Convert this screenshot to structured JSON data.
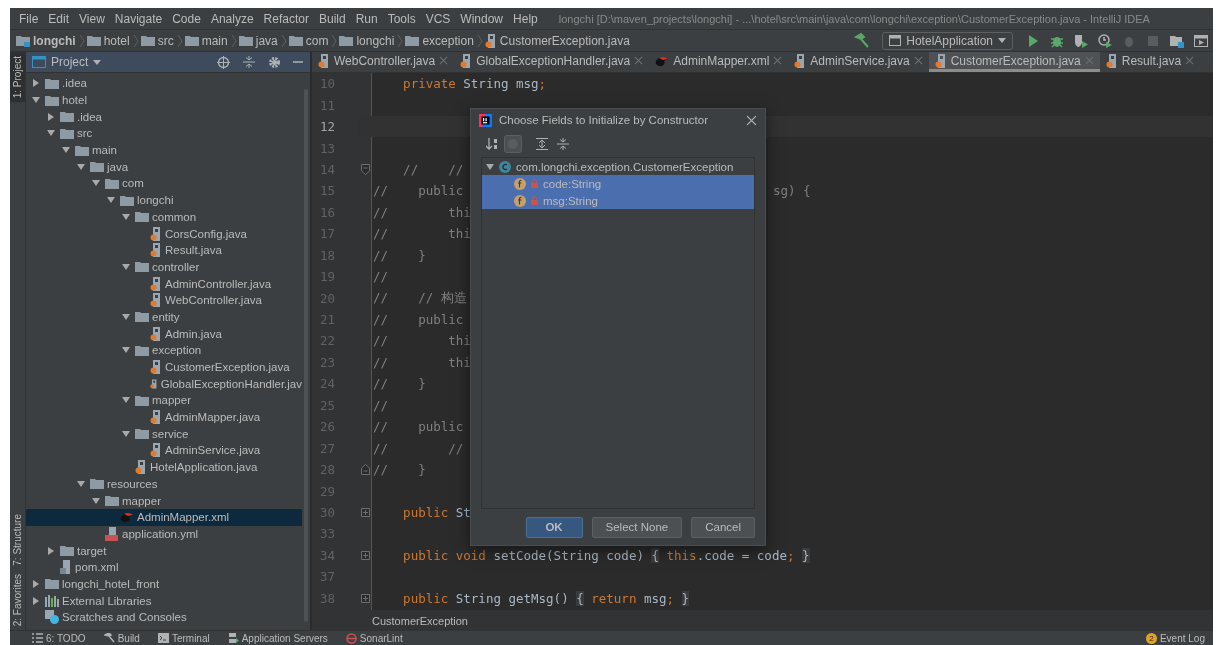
{
  "window": {
    "title": "longchi [D:\\maven_projects\\longchi] - ...\\hotel\\src\\main\\java\\com\\longchi\\exception\\CustomerException.java - IntelliJ IDEA"
  },
  "menu": [
    "File",
    "Edit",
    "View",
    "Navigate",
    "Code",
    "Analyze",
    "Refactor",
    "Build",
    "Run",
    "Tools",
    "VCS",
    "Window",
    "Help"
  ],
  "breadcrumbs": [
    {
      "label": "longchi",
      "kind": "module"
    },
    {
      "label": "hotel",
      "kind": "folder"
    },
    {
      "label": "src",
      "kind": "folder"
    },
    {
      "label": "main",
      "kind": "folder"
    },
    {
      "label": "java",
      "kind": "folder"
    },
    {
      "label": "com",
      "kind": "folder"
    },
    {
      "label": "longchi",
      "kind": "folder"
    },
    {
      "label": "exception",
      "kind": "folder"
    },
    {
      "label": "CustomerException.java",
      "kind": "java"
    }
  ],
  "run_config": {
    "label": "HotelApplication"
  },
  "toolbar": [
    {
      "kind": "run",
      "disabled": false
    },
    {
      "kind": "debug",
      "disabled": false
    },
    {
      "kind": "coverage",
      "disabled": false
    },
    {
      "kind": "profile",
      "disabled": false
    },
    {
      "kind": "attach",
      "disabled": true
    },
    {
      "kind": "stop",
      "disabled": true
    },
    {
      "kind": "structure",
      "disabled": false
    },
    {
      "kind": "presentation",
      "disabled": false
    }
  ],
  "tool_strip": [
    {
      "label": "1: Project",
      "kind": "top",
      "selected": true
    },
    {
      "label": "7: Structure",
      "kind": "bottom",
      "selected": false
    },
    {
      "label": "2: Favorites",
      "kind": "bottom",
      "selected": false
    }
  ],
  "project_panel": {
    "title": "Project",
    "tree": [
      {
        "children": [
          {
            "label": ".idea",
            "kind": "folder",
            "expanded": false,
            "selected": false
          },
          {
            "label": "hotel",
            "kind": "folder",
            "expanded": true,
            "selected": false,
            "children": [
              {
                "label": ".idea",
                "kind": "folder",
                "expanded": false,
                "selected": false
              },
              {
                "label": "src",
                "kind": "folder",
                "expanded": true,
                "selected": false,
                "children": [
                  {
                    "label": "main",
                    "kind": "folder",
                    "expanded": true,
                    "selected": false,
                    "children": [
                      {
                        "label": "java",
                        "kind": "folder",
                        "expanded": true,
                        "selected": false,
                        "children": [
                          {
                            "label": "com",
                            "kind": "folder",
                            "expanded": true,
                            "selected": false,
                            "children": [
                              {
                                "label": "longchi",
                                "kind": "folder",
                                "expanded": true,
                                "selected": false,
                                "children": [
                                  {
                                    "label": "common",
                                    "kind": "folder",
                                    "expanded": true,
                                    "selected": false,
                                    "children": [
                                      {
                                        "label": "CorsConfig.java",
                                        "kind": "java",
                                        "selected": false
                                      },
                                      {
                                        "label": "Result.java",
                                        "kind": "java",
                                        "selected": false
                                      }
                                    ]
                                  },
                                  {
                                    "label": "controller",
                                    "kind": "folder",
                                    "expanded": true,
                                    "selected": false,
                                    "children": [
                                      {
                                        "label": "AdminController.java",
                                        "kind": "java",
                                        "selected": false
                                      },
                                      {
                                        "label": "WebController.java",
                                        "kind": "java",
                                        "selected": false
                                      }
                                    ]
                                  },
                                  {
                                    "label": "entity",
                                    "kind": "folder",
                                    "expanded": true,
                                    "selected": false,
                                    "children": [
                                      {
                                        "label": "Admin.java",
                                        "kind": "java",
                                        "selected": false
                                      }
                                    ]
                                  },
                                  {
                                    "label": "exception",
                                    "kind": "folder",
                                    "expanded": true,
                                    "selected": false,
                                    "children": [
                                      {
                                        "label": "CustomerException.java",
                                        "kind": "java",
                                        "selected": false
                                      },
                                      {
                                        "label": "GlobalExceptionHandler.jav",
                                        "kind": "java",
                                        "selected": false
                                      }
                                    ]
                                  },
                                  {
                                    "label": "mapper",
                                    "kind": "folder",
                                    "expanded": true,
                                    "selected": false,
                                    "children": [
                                      {
                                        "label": "AdminMapper.java",
                                        "kind": "java",
                                        "selected": false
                                      }
                                    ]
                                  },
                                  {
                                    "label": "service",
                                    "kind": "folder",
                                    "expanded": true,
                                    "selected": false,
                                    "children": [
                                      {
                                        "label": "AdminService.java",
                                        "kind": "java",
                                        "selected": false
                                      }
                                    ]
                                  },
                                  {
                                    "label": "HotelApplication.java",
                                    "kind": "java",
                                    "selected": false
                                  }
                                ]
                              }
                            ]
                          }
                        ]
                      },
                      {
                        "label": "resources",
                        "kind": "folder",
                        "expanded": true,
                        "selected": false,
                        "children": [
                          {
                            "label": "mapper",
                            "kind": "folder",
                            "expanded": true,
                            "selected": false,
                            "children": [
                              {
                                "label": "AdminMapper.xml",
                                "kind": "xml",
                                "selected": true
                              }
                            ]
                          },
                          {
                            "label": "application.yml",
                            "kind": "yml",
                            "selected": false
                          }
                        ]
                      }
                    ]
                  }
                ]
              },
              {
                "label": "target",
                "kind": "folder",
                "expanded": false,
                "selected": false
              },
              {
                "label": "pom.xml",
                "kind": "maven",
                "selected": false
              }
            ]
          },
          {
            "label": "longchi_hotel_front",
            "kind": "folder",
            "expanded": false,
            "selected": false
          }
        ]
      },
      {
        "label": "External Libraries",
        "kind": "libraries",
        "expanded": false,
        "selected": false
      },
      {
        "label": "Scratches and Consoles",
        "kind": "scratches",
        "selected": false
      }
    ]
  },
  "editor": {
    "tabs": [
      {
        "label": "WebController.java",
        "kind": "java",
        "selected": false
      },
      {
        "label": "GlobalExceptionHandler.java",
        "kind": "java",
        "selected": false
      },
      {
        "label": "AdminMapper.xml",
        "kind": "xml",
        "selected": false
      },
      {
        "label": "AdminService.java",
        "kind": "java",
        "selected": false
      },
      {
        "label": "CustomerException.java",
        "kind": "java",
        "selected": true
      },
      {
        "label": "Result.java",
        "kind": "java",
        "selected": false
      }
    ],
    "lines": [
      {
        "number": "10",
        "current": false,
        "segments": [
          {
            "text": "    private",
            "kind": "keyword"
          },
          {
            "text": " String msg"
          },
          {
            "text": ";",
            "kind": "keyword"
          }
        ]
      },
      {
        "number": "11",
        "current": false
      },
      {
        "number": "12",
        "current": true
      },
      {
        "number": "13",
        "current": false
      },
      {
        "number": "14",
        "current": false,
        "kind": "open",
        "segments": [
          {
            "text": "    //    //",
            "kind": "comment"
          }
        ]
      },
      {
        "number": "15",
        "current": false,
        "segments": [
          {
            "text": "//    public",
            "kind": "comment"
          }
        ],
        "tail": [
          {
            "text": "sg) {",
            "kind": "comment"
          }
        ]
      },
      {
        "number": "16",
        "current": false,
        "segments": [
          {
            "text": "//        thi",
            "kind": "comment"
          }
        ]
      },
      {
        "number": "17",
        "current": false,
        "segments": [
          {
            "text": "//        thi",
            "kind": "comment"
          }
        ]
      },
      {
        "number": "18",
        "current": false,
        "segments": [
          {
            "text": "//    }",
            "kind": "comment"
          }
        ]
      },
      {
        "number": "19",
        "current": false,
        "segments": [
          {
            "text": "//",
            "kind": "comment"
          }
        ]
      },
      {
        "number": "20",
        "current": false,
        "segments": [
          {
            "text": "//    // 构造",
            "kind": "comment"
          }
        ]
      },
      {
        "number": "21",
        "current": false,
        "segments": [
          {
            "text": "//    public",
            "kind": "comment"
          }
        ]
      },
      {
        "number": "22",
        "current": false,
        "segments": [
          {
            "text": "//        thi",
            "kind": "comment"
          }
        ]
      },
      {
        "number": "23",
        "current": false,
        "segments": [
          {
            "text": "//        thi",
            "kind": "comment"
          }
        ]
      },
      {
        "number": "24",
        "current": false,
        "segments": [
          {
            "text": "//    }",
            "kind": "comment"
          }
        ]
      },
      {
        "number": "25",
        "current": false,
        "segments": [
          {
            "text": "//",
            "kind": "comment"
          }
        ]
      },
      {
        "number": "26",
        "current": false,
        "segments": [
          {
            "text": "//    public",
            "kind": "comment"
          }
        ]
      },
      {
        "number": "27",
        "current": false,
        "segments": [
          {
            "text": "//        //",
            "kind": "comment"
          }
        ]
      },
      {
        "number": "28",
        "current": false,
        "kind": "close",
        "segments": [
          {
            "text": "//    }",
            "kind": "comment"
          }
        ]
      },
      {
        "number": "29",
        "current": false
      },
      {
        "number": "30",
        "current": false,
        "kind": "collapsed",
        "segments": [
          {
            "text": "    public",
            "kind": "keyword"
          },
          {
            "text": " St"
          }
        ]
      },
      {
        "number": "33",
        "current": false
      },
      {
        "number": "34",
        "current": false,
        "kind": "collapsed",
        "segments": [
          {
            "text": "    public void",
            "kind": "keyword"
          },
          {
            "text": " setCode(String code) "
          },
          {
            "text": "{",
            "kind": "folded"
          },
          {
            "text": " this",
            "kind": "keyword"
          },
          {
            "text": ".code = code"
          },
          {
            "text": "; ",
            "kind": "keyword"
          },
          {
            "text": "}",
            "kind": "folded"
          }
        ]
      },
      {
        "number": "37",
        "current": false
      },
      {
        "number": "38",
        "current": false,
        "kind": "collapsed",
        "segments": [
          {
            "text": "    public",
            "kind": "keyword"
          },
          {
            "text": " String getMsg() "
          },
          {
            "text": "{",
            "kind": "folded"
          },
          {
            "text": " return",
            "kind": "keyword"
          },
          {
            "text": " msg"
          },
          {
            "text": "; ",
            "kind": "keyword"
          },
          {
            "text": "}",
            "kind": "folded"
          }
        ]
      }
    ],
    "breadcrumb": "CustomerException"
  },
  "dialog": {
    "title": "Choose Fields to Initialize by Constructor",
    "toolbar": [
      {
        "kind": "sort",
        "pressed": false
      },
      {
        "kind": "show-classes",
        "pressed": true
      },
      {
        "kind": "expand",
        "pressed": false
      },
      {
        "kind": "collapse",
        "pressed": false
      }
    ],
    "class_node": {
      "label": "com.longchi.exception.CustomerException",
      "expanded": true
    },
    "fields": [
      {
        "label": "code:String",
        "selected": true
      },
      {
        "label": "msg:String",
        "selected": true
      }
    ],
    "buttons": [
      {
        "label": "OK",
        "default": true
      },
      {
        "label": "Select None",
        "default": false
      },
      {
        "label": "Cancel",
        "default": false
      }
    ]
  },
  "status_bar": {
    "tools": [
      {
        "label": "6: TODO",
        "kind": "todo"
      },
      {
        "label": "Build",
        "kind": "build"
      },
      {
        "label": "Terminal",
        "kind": "terminal"
      },
      {
        "label": "Application Servers",
        "kind": "servers"
      },
      {
        "label": "SonarLint",
        "kind": "sonar"
      }
    ],
    "event_log": {
      "count": "2",
      "label": "Event Log"
    }
  }
}
